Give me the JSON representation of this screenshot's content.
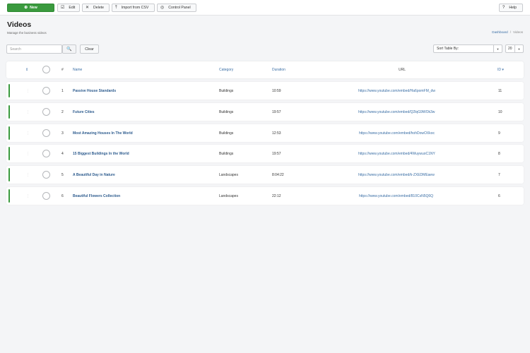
{
  "toolbar": {
    "new_label": "New",
    "edit_label": "Edit",
    "delete_label": "Delete",
    "import_label": "Import from CSV",
    "cpanel_label": "Control Panel",
    "help_label": "Help",
    "new_color": "#3a9a3e"
  },
  "header": {
    "title": "Videos",
    "subtitle": "Manage the business videos",
    "breadcrumb": [
      "Dashboard",
      "/",
      "Videos"
    ]
  },
  "filters": {
    "search_placeholder": "Search",
    "search_value": "",
    "clear_label": "Clear",
    "sort_label": "Sort Table By:",
    "limit_value": "20"
  },
  "table": {
    "columns": {
      "order": "⇕",
      "num": "#",
      "name": "Name",
      "category": "Category",
      "duration": "Duration",
      "url": "URL",
      "id": "ID ▾"
    },
    "rows": [
      {
        "num": "1",
        "name": "Passive House Standards",
        "category": "Buildings",
        "duration": "10:59",
        "url": "https://www.youtube.com/embed/Ha6pomFM_dw",
        "id": "11"
      },
      {
        "num": "2",
        "name": "Future Cities",
        "category": "Buildings",
        "duration": "19:57",
        "url": "https://www.youtube.com/embed/Q2lqG9WOk3w",
        "id": "10"
      },
      {
        "num": "3",
        "name": "Most Amazing Houses In The World",
        "category": "Buildings",
        "duration": "12:53",
        "url": "https://www.youtube.com/embed/hohDowOXkoc",
        "id": "9"
      },
      {
        "num": "4",
        "name": "15 Biggest Buildings In the World",
        "category": "Buildings",
        "duration": "19:57",
        "url": "https://www.youtube.com/embed/4WuywuoC1NY",
        "id": "8"
      },
      {
        "num": "5",
        "name": "A Beautiful Day in Nature",
        "category": "Landscapes",
        "duration": "8:04:22",
        "url": "https://www.youtube.com/embed/k-ZXEDMEaew",
        "id": "7"
      },
      {
        "num": "6",
        "name": "Beautiful Flowers Collection",
        "category": "Landscapes",
        "duration": "22:12",
        "url": "https://www.youtube.com/embed/810CsN5Q6Q",
        "id": "6"
      }
    ]
  }
}
